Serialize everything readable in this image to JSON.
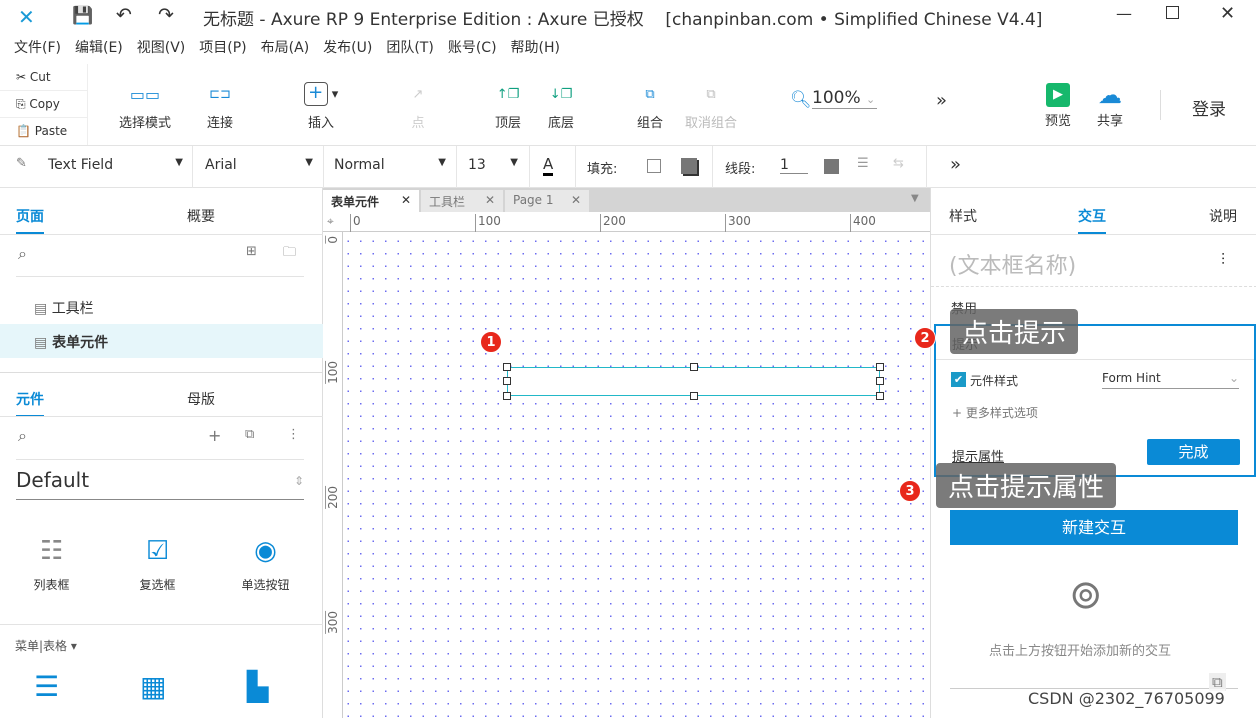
{
  "window": {
    "title": "无标题 - Axure RP 9 Enterprise Edition : Axure 已授权    [chanpinban.com • Simplified Chinese V4.4]"
  },
  "menu": [
    "文件(F)",
    "编辑(E)",
    "视图(V)",
    "项目(P)",
    "布局(A)",
    "发布(U)",
    "团队(T)",
    "账号(C)",
    "帮助(H)"
  ],
  "clipboard": {
    "cut": "Cut",
    "copy": "Copy",
    "paste": "Paste"
  },
  "toolbar": {
    "select_mode": "选择模式",
    "connect": "连接",
    "insert": "插入",
    "point": "点",
    "top": "顶层",
    "bottom": "底层",
    "group": "组合",
    "ungroup": "取消组合",
    "zoom": "100%",
    "preview": "预览",
    "share": "共享",
    "login": "登录"
  },
  "format": {
    "widget_type": "Text Field",
    "font": "Arial",
    "weight": "Normal",
    "size": "13",
    "fill_label": "填充:",
    "line_label": "线段:",
    "line_value": "1"
  },
  "pages_panel": {
    "tab_pages": "页面",
    "tab_outline": "概要",
    "pages": [
      "工具栏",
      "表单元件"
    ],
    "selected": "表单元件"
  },
  "library_panel": {
    "tab_widgets": "元件",
    "tab_masters": "母版",
    "library": "Default",
    "widgets": [
      "列表框",
      "复选框",
      "单选按钮"
    ],
    "section": "菜单|表格 ▾"
  },
  "canvas": {
    "tabs": [
      "表单元件",
      "工具栏",
      "Page 1"
    ],
    "ruler_x": [
      "0",
      "100",
      "200",
      "300",
      "400"
    ],
    "ruler_y": [
      "0",
      "100",
      "200",
      "300"
    ]
  },
  "right_panel": {
    "tabs": [
      "样式",
      "交互",
      "说明"
    ],
    "active_tab": "交互",
    "name_placeholder": "(文本框名称)",
    "disabled": "禁用",
    "hint": "提示",
    "widget_style": "元件样式",
    "style_value": "Form Hint",
    "more_styles": "+ 更多样式选项",
    "hint_props": "提示属性",
    "done": "完成",
    "new_interaction": "新建交互",
    "empty_text": "点击上方按钮开始添加新的交互"
  },
  "annotations": [
    {
      "num": "1"
    },
    {
      "num": "2",
      "text": "点击提示"
    },
    {
      "num": "3",
      "text": "点击提示属性"
    }
  ],
  "watermark": "CSDN @2302_76705099",
  "colors": {
    "accent": "#0a8ad6",
    "badge": "#e8281b",
    "selection": "#22b8c8"
  }
}
